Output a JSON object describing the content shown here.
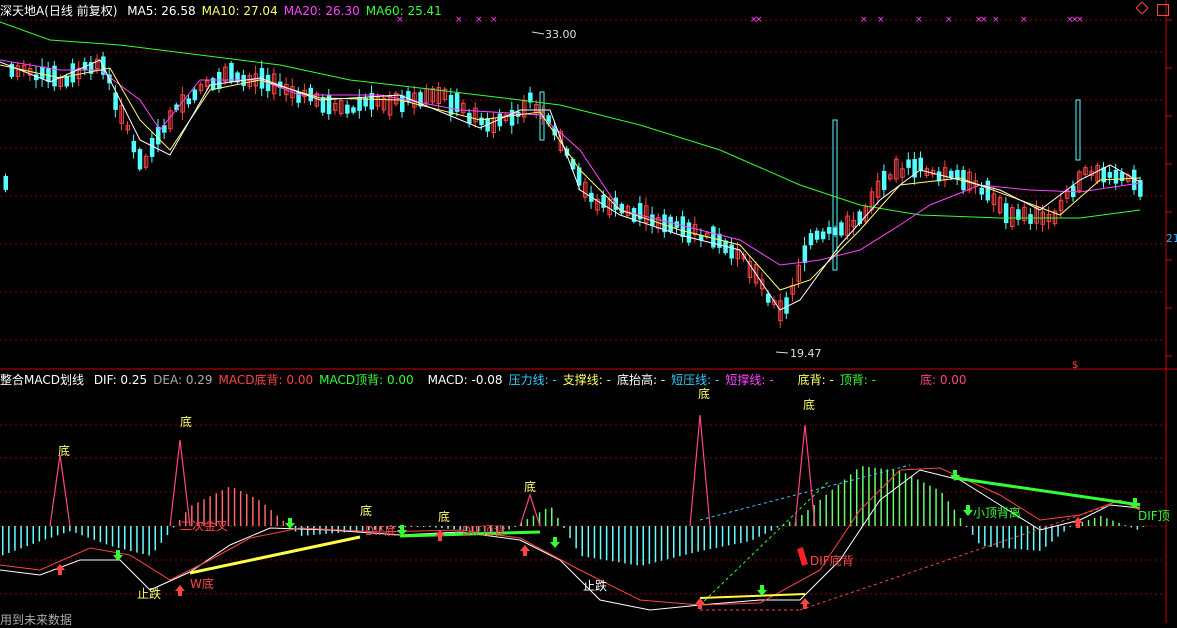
{
  "top_panel": {
    "title": "深天地A",
    "mode": "(日线 前复权)",
    "indicators": [
      {
        "label": "MA5: 26.58",
        "color": "#ffffff"
      },
      {
        "label": "MA10: 27.04",
        "color": "#ffff66"
      },
      {
        "label": "MA20: 26.30",
        "color": "#ff44ff"
      },
      {
        "label": "MA60: 25.41",
        "color": "#33ff33"
      }
    ],
    "high_label": "33.00",
    "low_label": "19.47",
    "axis_badge": "21"
  },
  "bottom_panel": {
    "title": "整合MACD划线",
    "fields": [
      {
        "label": "DIF: 0.25",
        "color": "#ffffff"
      },
      {
        "label": "DEA: 0.29",
        "color": "#aaaaaa"
      },
      {
        "label": "MACD底背: 0.00",
        "color": "#ff4444"
      },
      {
        "label": "MACD顶背: 0.00",
        "color": "#33ff33"
      },
      {
        "label": "MACD: -0.08",
        "color": "#ffffff"
      },
      {
        "label": "压力线: -",
        "color": "#33ccff"
      },
      {
        "label": "支撑线: -",
        "color": "#ffff66"
      },
      {
        "label": "底抬高: -",
        "color": "#ffffff"
      },
      {
        "label": "短压线: -",
        "color": "#33ccff"
      },
      {
        "label": "短撑线: -",
        "color": "#ff44ff"
      },
      {
        "label": "底背: -",
        "color": "#ffff66"
      },
      {
        "label": "顶背: -",
        "color": "#33ff33"
      },
      {
        "label": "底: 0.00",
        "color": "#ff4488"
      }
    ],
    "annotations": {
      "di": "底",
      "zhidie": "止跌",
      "w_di": "W底",
      "dif_dibei": "DIF底背",
      "xiao_dingbeili": "小顶背离",
      "dif_ding": "DIF顶",
      "jiaocha": "二次金叉",
      "dif_di": "DIF底",
      "dif_ding_small": "DIF顶背"
    }
  },
  "footer": "用到未来数据",
  "colors": {
    "up": "#ff4444",
    "down": "#54ffff",
    "grid": "#8b0000",
    "ma5": "#ffffff",
    "ma10": "#ffff66",
    "ma20": "#ff44ff",
    "ma60": "#33ff33"
  }
}
